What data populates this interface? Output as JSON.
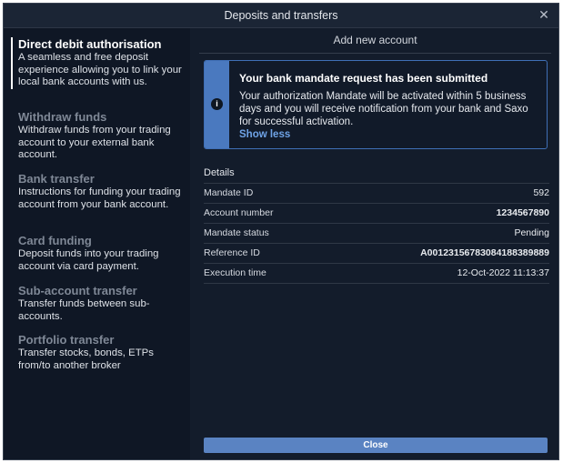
{
  "window": {
    "title": "Deposits and transfers",
    "close_icon": "close-icon"
  },
  "sidebar": {
    "items": [
      {
        "title": "Direct debit authorisation",
        "description": "A seamless and free deposit experience allowing you to link your local bank accounts with us.",
        "active": true
      },
      {
        "title": "Withdraw funds",
        "description": "Withdraw funds from your trading account to your external bank account.",
        "active": false
      },
      {
        "title": "Bank transfer",
        "description": "Instructions for funding your trading account from your bank account.",
        "active": false
      },
      {
        "title": "Card funding",
        "description": "Deposit funds into your trading account via card payment.",
        "active": false
      },
      {
        "title": "Sub-account transfer",
        "description": "Transfer funds between sub-accounts.",
        "active": false
      },
      {
        "title": "Portfolio transfer",
        "description": "Transfer stocks, bonds, ETPs from/to another broker",
        "active": false
      }
    ]
  },
  "main": {
    "header": "Add new account",
    "notice": {
      "icon": "info-icon",
      "heading": "Your bank mandate request has been submitted",
      "text": "Your authorization Mandate will be activated within 5 business days and you will receive notification from your bank and Saxo for successful activation.",
      "toggle_label": "Show less"
    },
    "details": {
      "label": "Details",
      "rows": [
        {
          "key": "Mandate ID",
          "value": "592"
        },
        {
          "key": "Account number",
          "value": "1234567890"
        },
        {
          "key": "Mandate status",
          "value": "Pending"
        },
        {
          "key": "Reference ID",
          "value": "A00123156783084188389889"
        },
        {
          "key": "Execution time",
          "value": "12-Oct-2022 11:13:37"
        }
      ]
    },
    "close_label": "Close"
  },
  "colors": {
    "background": "#131c2b",
    "sidebar": "#0f1725",
    "accent": "#4a79bf",
    "button": "#5a83c2",
    "link": "#6fa3e6"
  }
}
